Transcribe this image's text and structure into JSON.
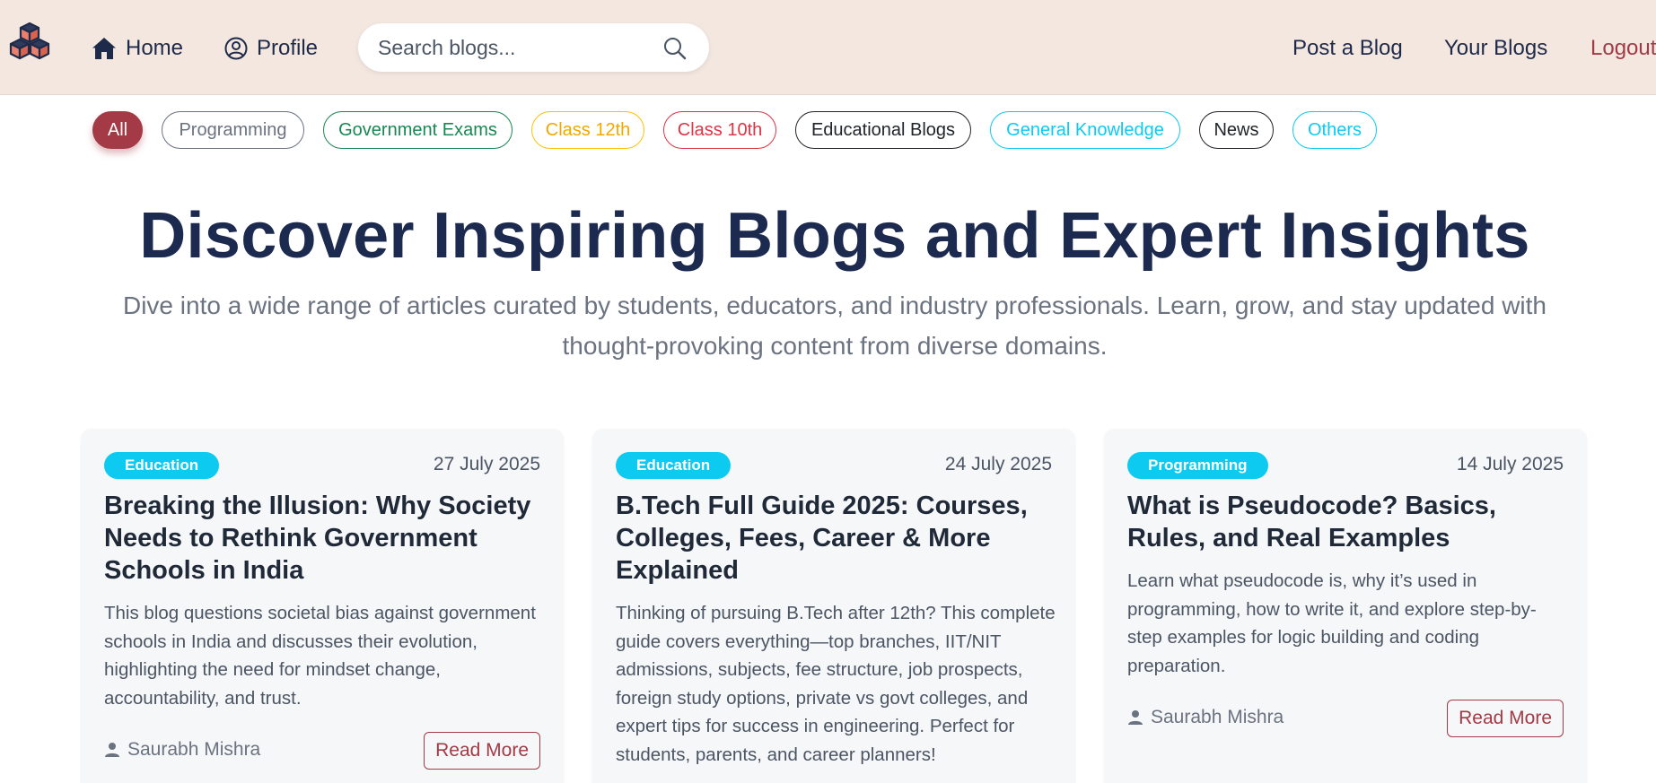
{
  "nav": {
    "home": "Home",
    "profile": "Profile",
    "search_placeholder": "Search blogs...",
    "post": "Post a Blog",
    "your_blogs": "Your Blogs",
    "logout": "Logout"
  },
  "categories": [
    "All",
    "Programming",
    "Government Exams",
    "Class 12th",
    "Class 10th",
    "Educational Blogs",
    "General Knowledge",
    "News",
    "Others"
  ],
  "hero": {
    "title": "Discover Inspiring Blogs and Expert Insights",
    "subtitle": "Dive into a wide range of articles curated by students, educators, and industry professionals. Learn, grow, and stay updated with thought-provoking content from diverse domains."
  },
  "cards": [
    {
      "category": "Education",
      "date": "27 July 2025",
      "title": "Breaking the Illusion: Why Society Needs to Rethink Government Schools in India",
      "description": "This blog questions societal bias against government schools in India and discusses their evolution, highlighting the need for mindset change, accountability, and trust.",
      "author": "Saurabh Mishra",
      "read_more": "Read More"
    },
    {
      "category": "Education",
      "date": "24 July 2025",
      "title": "B.Tech Full Guide 2025: Courses, Colleges, Fees, Career & More Explained",
      "description": "Thinking of pursuing B.Tech after 12th? This complete guide covers everything—top branches, IIT/NIT admissions, subjects, fee structure, job prospects, foreign study options, private vs govt colleges, and expert tips for success in engineering. Perfect for students, parents, and career planners!"
    },
    {
      "category": "Programming",
      "date": "14 July 2025",
      "title": "What is Pseudocode? Basics, Rules, and Real Examples",
      "description": "Learn what pseudocode is, why it’s used in programming, how to write it, and explore step-by-step examples for logic building and coding preparation.",
      "author": "Saurabh Mishra",
      "read_more": "Read More"
    }
  ],
  "colors": {
    "navbar_bg": "#f3e7e0",
    "accent": "#a33a45",
    "navy": "#1b2a4e",
    "badge": "#0dcaf0"
  },
  "icons": [
    "cubes-logo-icon",
    "home-icon",
    "user-circle-icon",
    "search-icon",
    "user-icon"
  ]
}
